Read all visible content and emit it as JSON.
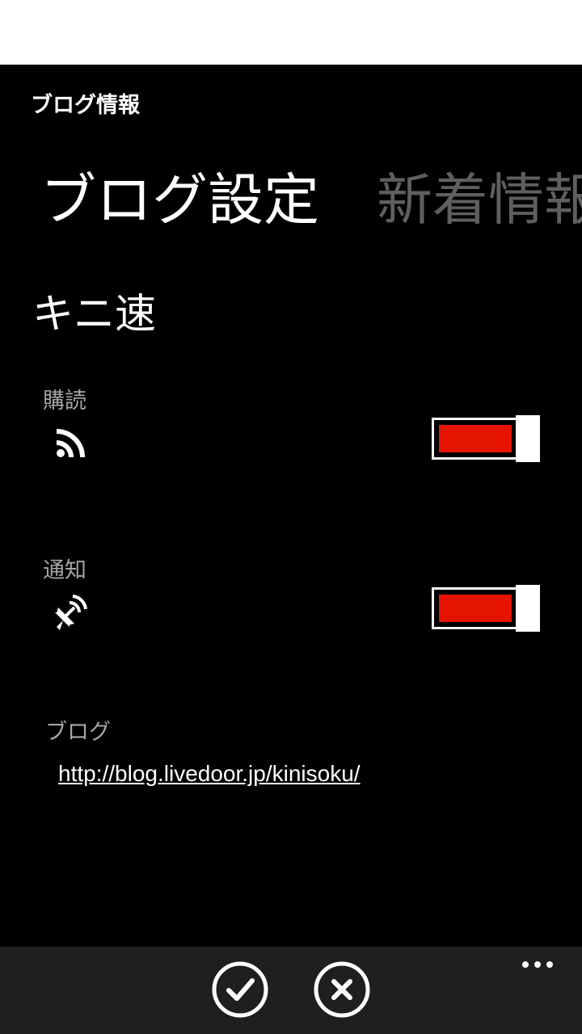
{
  "app": {
    "title": "ブログ情報"
  },
  "pivot": {
    "active_header": "ブログ設定",
    "next_header": "新着情報"
  },
  "blog": {
    "name": "キニ速",
    "subscribe": {
      "label": "購読",
      "icon": "rss-icon",
      "on": true
    },
    "notify": {
      "label": "通知",
      "icon": "satellite-dish-icon",
      "on": true
    },
    "blog_label": "ブログ",
    "url": "http://blog.livedoor.jp/kinisoku/"
  },
  "app_bar": {
    "buttons": [
      {
        "icon": "check-icon"
      },
      {
        "icon": "close-icon"
      }
    ],
    "more_icon": "ellipsis-icon"
  },
  "colors": {
    "accent": "#e51400",
    "background": "#000000",
    "app_bar": "#1f1f1f",
    "inactive_header": "#5f5f5f",
    "label": "#a6a6a6"
  }
}
